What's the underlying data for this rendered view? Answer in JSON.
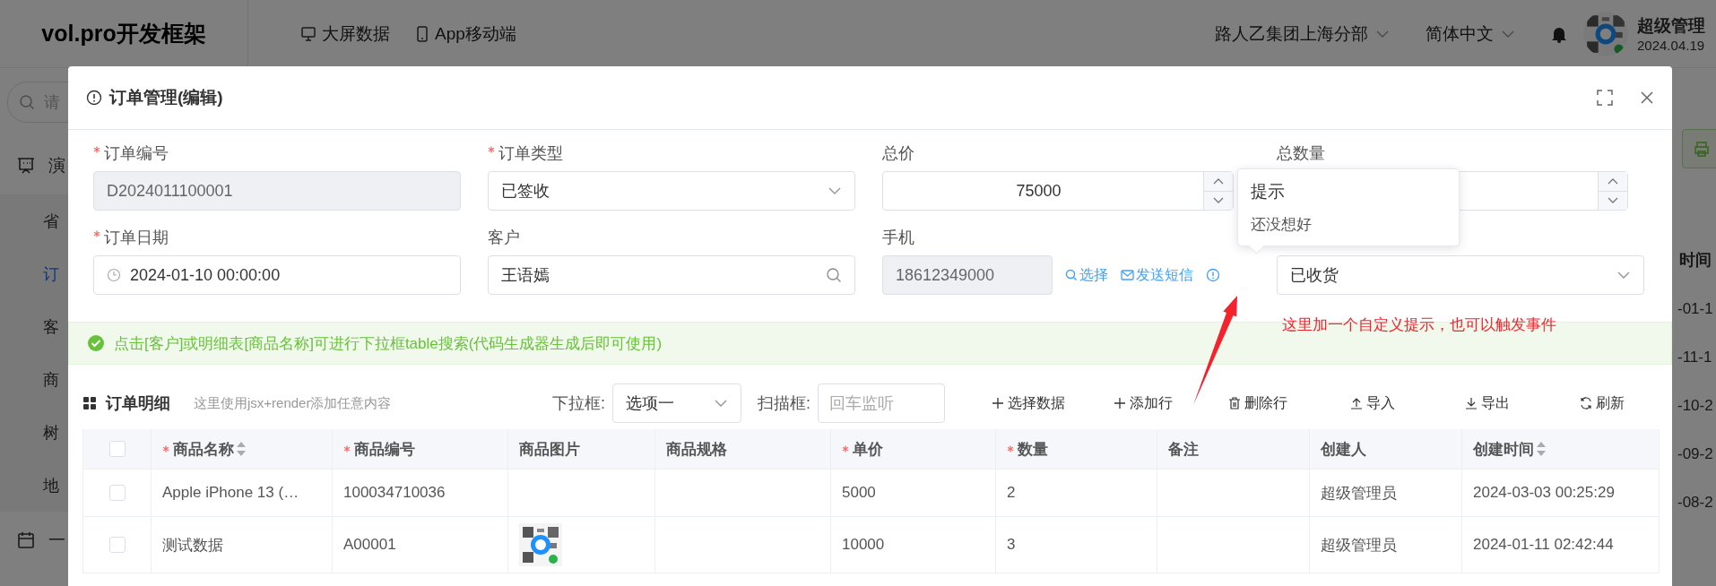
{
  "header": {
    "logo": "vol.pro开发框架",
    "nav": [
      {
        "label": "大屏数据"
      },
      {
        "label": "App移动端"
      }
    ],
    "org": "路人乙集团上海分部",
    "language": "简体中文",
    "user": {
      "name": "超级管理",
      "date": "2024.04.19"
    }
  },
  "sidebar": {
    "search_placeholder": "请",
    "items": [
      {
        "kind": "group",
        "label": "演",
        "selected": false
      },
      {
        "kind": "item",
        "label": "省",
        "selected": false
      },
      {
        "kind": "item",
        "label": "订",
        "selected": true
      },
      {
        "kind": "item",
        "label": "客",
        "selected": false
      },
      {
        "kind": "item",
        "label": "商",
        "selected": false
      },
      {
        "kind": "item",
        "label": "树",
        "selected": false
      },
      {
        "kind": "item",
        "label": "地",
        "selected": false
      },
      {
        "kind": "group",
        "label": "一",
        "selected": false
      }
    ]
  },
  "background_table": {
    "column_header": "时间",
    "cells": [
      "-01-1",
      "-11-1",
      "-10-2",
      "-09-2",
      "-08-2"
    ]
  },
  "dialog": {
    "title": "订单管理(编辑)",
    "fields": [
      {
        "label": "订单编号",
        "required": true,
        "kind": "text",
        "value": "D2024011100001",
        "disabled": true
      },
      {
        "label": "订单类型",
        "required": true,
        "kind": "select",
        "value": "已签收",
        "disabled": false
      },
      {
        "label": "总价",
        "required": false,
        "kind": "number",
        "value": "75000",
        "disabled": false
      },
      {
        "label": "总数量",
        "required": false,
        "kind": "number",
        "disabled": false
      },
      {
        "label": "订单日期",
        "required": true,
        "kind": "date",
        "value": "2024-01-10 00:00:00",
        "disabled": false
      },
      {
        "label": "客户",
        "required": false,
        "kind": "search",
        "value": "王语嫣",
        "disabled": false
      },
      {
        "label": "手机",
        "required": false,
        "kind": "text",
        "value": "18612349000",
        "disabled": true,
        "links": [
          {
            "label": "选择"
          },
          {
            "label": "发送短信"
          }
        ],
        "info": true
      },
      {
        "kind": "select",
        "value": "已收货",
        "disabled": false
      }
    ],
    "tooltip": {
      "title": "提示",
      "text": "还没想好"
    },
    "annotation": "这里加一个自定义提示，也可以触发事件",
    "alert": "点击[客户]或明细表[商品名称]可进行下拉框table搜索(代码生成器生成后即可使用)",
    "detail": {
      "title": "订单明细",
      "hint": "这里使用jsx+render添加任意内容",
      "dropdown": {
        "label": "下拉框:",
        "value": "选项一"
      },
      "scanner": {
        "label": "扫描框:",
        "placeholder": "回车监听"
      },
      "actions": [
        {
          "label": "选择数据",
          "kind": "add"
        },
        {
          "label": "添加行",
          "kind": "add"
        },
        {
          "label": "删除行",
          "kind": "delete"
        },
        {
          "label": "导入",
          "kind": "import"
        },
        {
          "label": "导出",
          "kind": "export"
        },
        {
          "label": "刷新",
          "kind": "refresh"
        }
      ]
    },
    "table": {
      "header_checked": false,
      "columns": [
        {
          "label": "商品名称",
          "required": true,
          "sortable": true
        },
        {
          "label": "商品编号",
          "required": true,
          "sortable": false
        },
        {
          "label": "商品图片",
          "required": false,
          "sortable": false
        },
        {
          "label": "商品规格",
          "required": false,
          "sortable": false
        },
        {
          "label": "单价",
          "required": true,
          "sortable": false
        },
        {
          "label": "数量",
          "required": true,
          "sortable": false
        },
        {
          "label": "备注",
          "required": false,
          "sortable": false
        },
        {
          "label": "创建人",
          "required": false,
          "sortable": false
        },
        {
          "label": "创建时间",
          "required": false,
          "sortable": true
        }
      ],
      "rows": [
        {
          "checked": false,
          "name": "Apple iPhone 13 (…",
          "code": "100034710036",
          "image": false,
          "price": "5000",
          "quantity": "2",
          "creator": "超级管理员",
          "created": "2024-03-03 00:25:29"
        },
        {
          "checked": false,
          "name": "测试数据",
          "code": "A00001",
          "image": true,
          "price": "10000",
          "quantity": "3",
          "creator": "超级管理员",
          "created": "2024-01-11 02:42:44"
        }
      ]
    }
  }
}
